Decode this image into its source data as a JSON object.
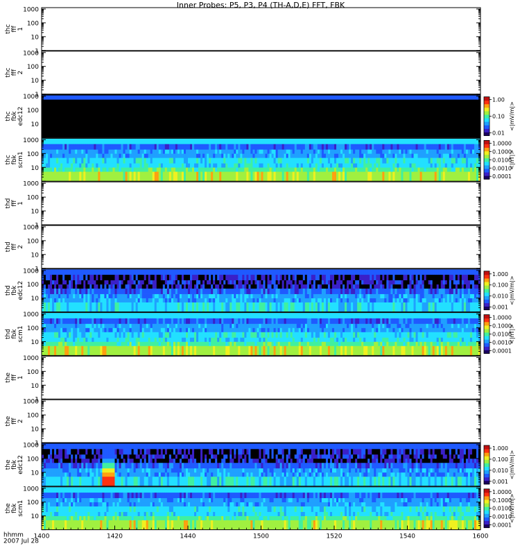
{
  "title": "Inner Probes: P5, P3, P4 (TH-A,D,E) FFT, FBK",
  "x_axis": {
    "ticks": [
      "1400",
      "1420",
      "1440",
      "1500",
      "1520",
      "1540",
      "1600"
    ],
    "row_label": "hhmm",
    "date_label": "2007 Jul 28"
  },
  "panels": [
    {
      "probe": "thc",
      "product": "fff",
      "channel": "1",
      "kind": "empty",
      "y_ticks": [
        "1000",
        "100",
        "10",
        "1"
      ]
    },
    {
      "probe": "thc",
      "product": "fff",
      "channel": "2",
      "kind": "empty",
      "y_ticks": [
        "1000",
        "100",
        "10",
        "1"
      ]
    },
    {
      "probe": "thc",
      "product": "fbk",
      "channel": "edc12",
      "kind": "spectrogram",
      "pattern": "blackout",
      "y_ticks": [
        "1000",
        "100",
        "10"
      ],
      "colorbar": {
        "unit": "<|mV/m|>",
        "ticks": [
          "1.00",
          "0.10",
          "0.01"
        ]
      }
    },
    {
      "probe": "thc",
      "product": "fbk",
      "channel": "scm1",
      "kind": "spectrogram",
      "pattern": "scm",
      "y_ticks": [
        "1000",
        "100",
        "10"
      ],
      "colorbar": {
        "unit": "<|nT|>",
        "ticks": [
          "1.0000",
          "0.1000",
          "0.0100",
          "0.0010",
          "0.0001"
        ]
      }
    },
    {
      "probe": "thd",
      "product": "fff",
      "channel": "1",
      "kind": "empty",
      "y_ticks": [
        "1000",
        "100",
        "10",
        "1"
      ]
    },
    {
      "probe": "thd",
      "product": "fff",
      "channel": "2",
      "kind": "empty",
      "y_ticks": [
        "1000",
        "100",
        "10",
        "1"
      ]
    },
    {
      "probe": "thd",
      "product": "fbk",
      "channel": "edc12",
      "kind": "spectrogram",
      "pattern": "edc",
      "y_ticks": [
        "1000",
        "100",
        "10"
      ],
      "colorbar": {
        "unit": "<|mV/m|>",
        "ticks": [
          "1.000",
          "0.100",
          "0.010",
          "0.001"
        ]
      }
    },
    {
      "probe": "thd",
      "product": "fbk",
      "channel": "scm1",
      "kind": "spectrogram",
      "pattern": "scm",
      "y_ticks": [
        "1000",
        "100",
        "10"
      ],
      "colorbar": {
        "unit": "<|nT|>",
        "ticks": [
          "1.0000",
          "0.1000",
          "0.0100",
          "0.0010",
          "0.0001"
        ]
      }
    },
    {
      "probe": "the",
      "product": "fff",
      "channel": "1",
      "kind": "empty",
      "y_ticks": [
        "1000",
        "100",
        "10",
        "1"
      ]
    },
    {
      "probe": "the",
      "product": "fff",
      "channel": "2",
      "kind": "empty",
      "y_ticks": [
        "1000",
        "100",
        "10",
        "1"
      ]
    },
    {
      "probe": "the",
      "product": "fbk",
      "channel": "edc12",
      "kind": "spectrogram",
      "pattern": "edc_burst",
      "y_ticks": [
        "1000",
        "100",
        "10"
      ],
      "colorbar": {
        "unit": "<|mV/m|>",
        "ticks": [
          "1.000",
          "0.100",
          "0.010",
          "0.001"
        ]
      }
    },
    {
      "probe": "the",
      "product": "fbk",
      "channel": "scm1",
      "kind": "spectrogram",
      "pattern": "scm",
      "y_ticks": [
        "1000",
        "100",
        "10"
      ],
      "colorbar": {
        "unit": "<|mV/m|>",
        "ticks": [
          "1.0000",
          "0.1000",
          "0.0100",
          "0.0010",
          "0.0001"
        ]
      }
    }
  ],
  "colormap": [
    "#1a0060",
    "#3a20c8",
    "#1f5aff",
    "#1fa0ff",
    "#22e0ff",
    "#40f0a0",
    "#a0f040",
    "#f0f020",
    "#ffa010",
    "#ff3010",
    "#c01010"
  ],
  "chart_data": {
    "type": "heatmap",
    "title": "Inner Probes: P5, P3, P4 (TH-A,D,E) FFT, FBK",
    "x_range": [
      "1400",
      "1600"
    ],
    "x_ticks": [
      "1400",
      "1420",
      "1440",
      "1500",
      "1520",
      "1540",
      "1600"
    ],
    "y_scale": "log",
    "y_range": [
      1,
      1000
    ],
    "series": [
      {
        "name": "thc fbk edc12",
        "unit": "<|mV/m|>",
        "color_range": [
          0.01,
          1.0
        ]
      },
      {
        "name": "thc fbk scm1",
        "unit": "<|nT|>",
        "color_range": [
          0.0001,
          1.0
        ]
      },
      {
        "name": "thd fbk edc12",
        "unit": "<|mV/m|>",
        "color_range": [
          0.001,
          1.0
        ]
      },
      {
        "name": "thd fbk scm1",
        "unit": "<|nT|>",
        "color_range": [
          0.0001,
          1.0
        ]
      },
      {
        "name": "the fbk edc12",
        "unit": "<|mV/m|>",
        "color_range": [
          0.001,
          1.0
        ]
      },
      {
        "name": "the fbk scm1",
        "unit": "<|mV/m|>",
        "color_range": [
          0.0001,
          1.0
        ]
      }
    ]
  }
}
